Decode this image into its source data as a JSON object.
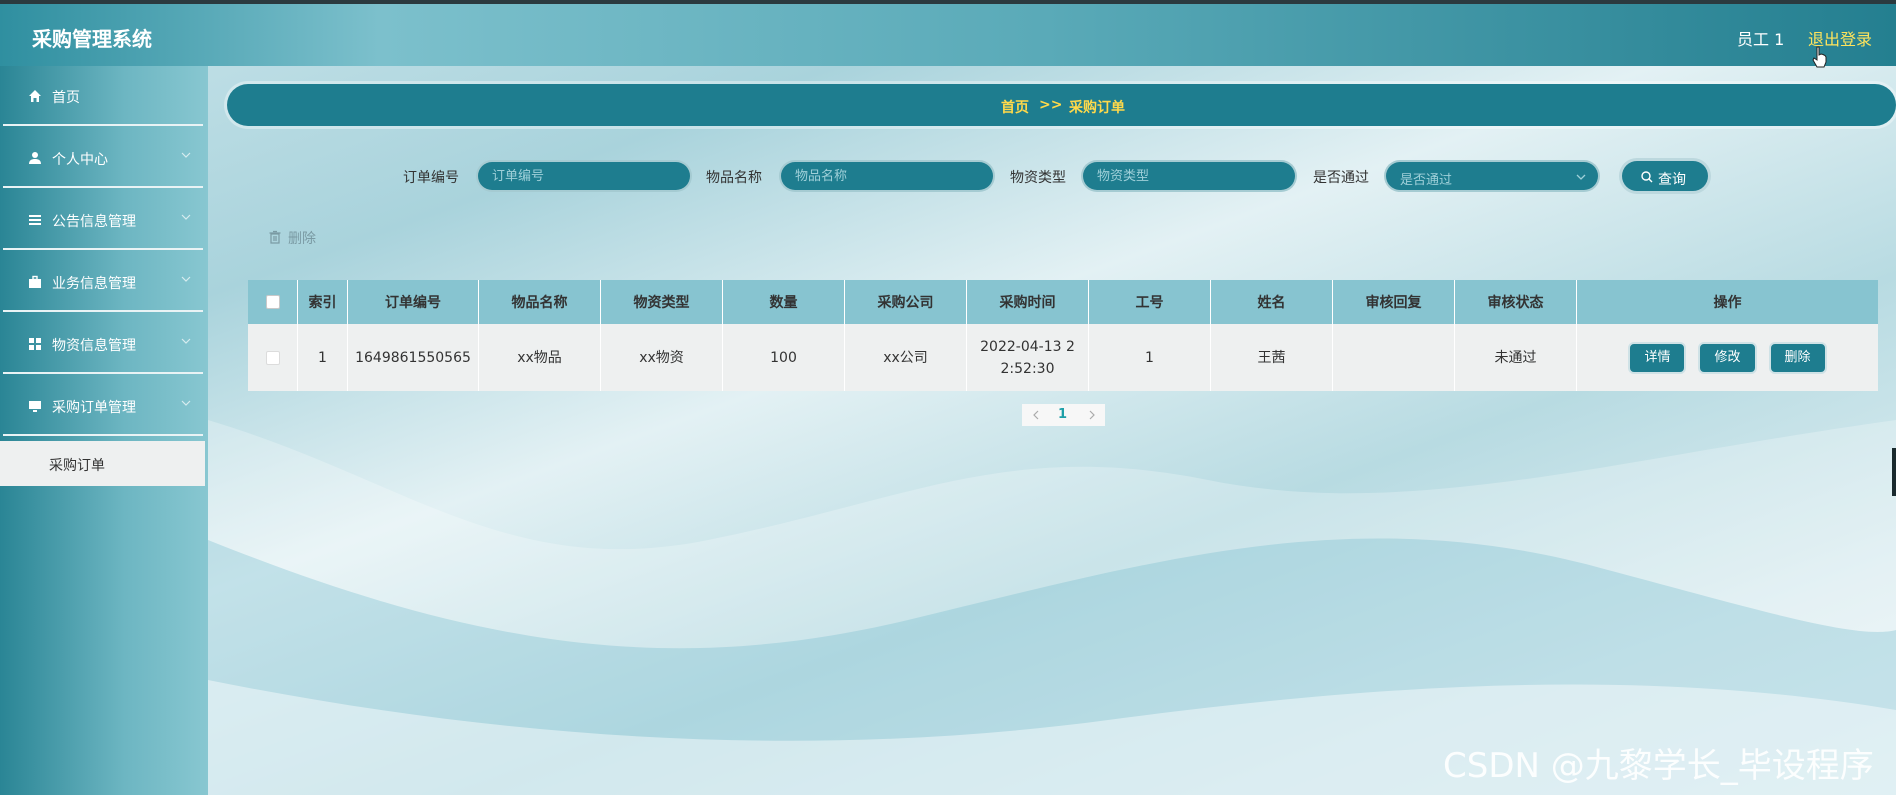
{
  "app": {
    "title": "采购管理系统"
  },
  "header": {
    "user_name": "员工 1",
    "logout_label": "退出登录"
  },
  "sidebar": {
    "items": [
      {
        "label": "首页",
        "icon": "home-icon"
      },
      {
        "label": "个人中心",
        "icon": "user-icon"
      },
      {
        "label": "公告信息管理",
        "icon": "list-icon"
      },
      {
        "label": "业务信息管理",
        "icon": "briefcase-icon"
      },
      {
        "label": "物资信息管理",
        "icon": "grid-icon"
      },
      {
        "label": "采购订单管理",
        "icon": "monitor-icon"
      }
    ],
    "active_sub": "采购订单"
  },
  "breadcrumb": {
    "home": "首页",
    "separator": ">>",
    "current": "采购订单"
  },
  "search": {
    "order_no_label": "订单编号",
    "order_no_placeholder": "订单编号",
    "item_name_label": "物品名称",
    "item_name_placeholder": "物品名称",
    "material_type_label": "物资类型",
    "material_type_placeholder": "物资类型",
    "passed_label": "是否通过",
    "passed_placeholder": "是否通过",
    "query_label": "查询"
  },
  "actions": {
    "batch_delete_label": "删除"
  },
  "table": {
    "headers": [
      "索引",
      "订单编号",
      "物品名称",
      "物资类型",
      "数量",
      "采购公司",
      "采购时间",
      "工号",
      "姓名",
      "审核回复",
      "审核状态",
      "操作"
    ],
    "rows": [
      {
        "index": "1",
        "order_no": "1649861550565",
        "item_name": "xx物品",
        "material_type": "xx物资",
        "quantity": "100",
        "company": "xx公司",
        "time_line1": "2022-04-13 2",
        "time_line2": "2:52:30",
        "job_no": "1",
        "name": "王茜",
        "review_reply": "",
        "review_status": "未通过",
        "btn_detail": "详情",
        "btn_edit": "修改",
        "btn_delete": "删除"
      }
    ]
  },
  "pagination": {
    "current_page": "1"
  },
  "watermark": "CSDN @九黎学长_毕设程序",
  "colors": {
    "primary": "#1e7d8f",
    "accent": "#ffd94a",
    "header_bg": "#5aaab8"
  }
}
